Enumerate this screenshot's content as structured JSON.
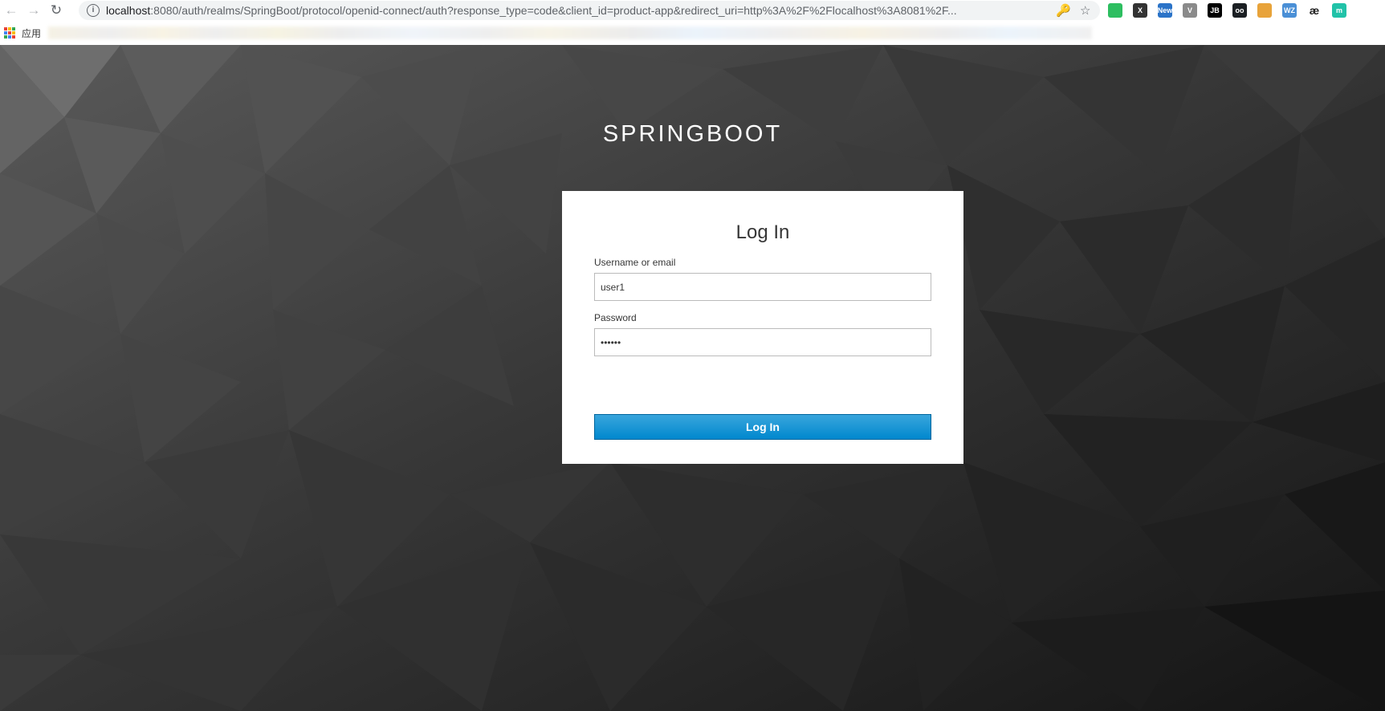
{
  "browser": {
    "url_host": "localhost",
    "url_rest": ":8080/auth/realms/SpringBoot/protocol/openid-connect/auth?response_type=code&client_id=product-app&redirect_uri=http%3A%2F%2Flocalhost%3A8081%2F...",
    "extensions": [
      {
        "name": "evernote-icon",
        "text": "",
        "color": "#2dbe60"
      },
      {
        "name": "x-extension-icon",
        "text": "X",
        "color": "#333333"
      },
      {
        "name": "new-extension-icon",
        "text": "New",
        "color": "#2a73c8"
      },
      {
        "name": "vue-devtools-icon",
        "text": "V",
        "color": "#8a8a8a"
      },
      {
        "name": "jetbrains-icon",
        "text": "JB",
        "color": "#000000"
      },
      {
        "name": "octotree-icon",
        "text": "oo",
        "color": "#1b1f23"
      },
      {
        "name": "chrome-extension-icon",
        "text": "",
        "color": "#e8a33a"
      },
      {
        "name": "wz-extension-icon",
        "text": "WZ",
        "color": "#4a8fd6"
      },
      {
        "name": "ae-extension-icon",
        "text": "æ",
        "color": "#ffffff"
      },
      {
        "name": "m-extension-icon",
        "text": "m",
        "color": "#21c2a8"
      }
    ]
  },
  "bookmarks": {
    "apps_label": "应用"
  },
  "page": {
    "realm_title": "SPRINGBOOT",
    "login_title": "Log In",
    "username_label": "Username or email",
    "username_value": "user1",
    "password_label": "Password",
    "password_value": "••••••",
    "submit_label": "Log In",
    "button_color": "#0088ce"
  }
}
